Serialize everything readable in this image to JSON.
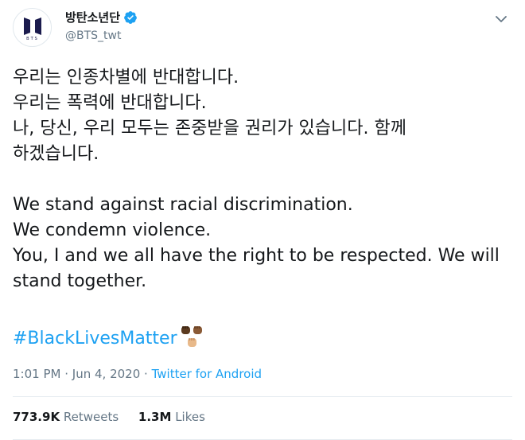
{
  "author": {
    "display_name": "방탄소년단",
    "handle": "@BTS_twt",
    "avatar_logo_text": "BTS",
    "avatar_icon": "bts-logo-icon",
    "verified_icon": "verified-badge-icon"
  },
  "menu_icon": "chevron-down-icon",
  "tweet": {
    "lines": [
      "우리는 인종차별에 반대합니다.",
      "우리는 폭력에 반대합니다.",
      "나, 당신, 우리 모두는 존중받을 권리가 있습니다. 함께",
      "하겠습니다.",
      "",
      "We stand against racial discrimination.",
      "We condemn violence.",
      "You, I and we all have the right to be respected. We will",
      "stand together."
    ],
    "hashtag": "#BlackLivesMatter",
    "emoji_icon": "raised-fists-emoji-icon"
  },
  "meta": {
    "time": "1:01 PM",
    "separator": "·",
    "date": "Jun 4, 2020",
    "source": "Twitter for Android"
  },
  "stats": {
    "retweets_count": "773.9K",
    "retweets_label": "Retweets",
    "likes_count": "1.3M",
    "likes_label": "Likes"
  },
  "colors": {
    "link": "#1da1f2",
    "secondary_text": "#657786",
    "primary_text": "#14171a"
  }
}
